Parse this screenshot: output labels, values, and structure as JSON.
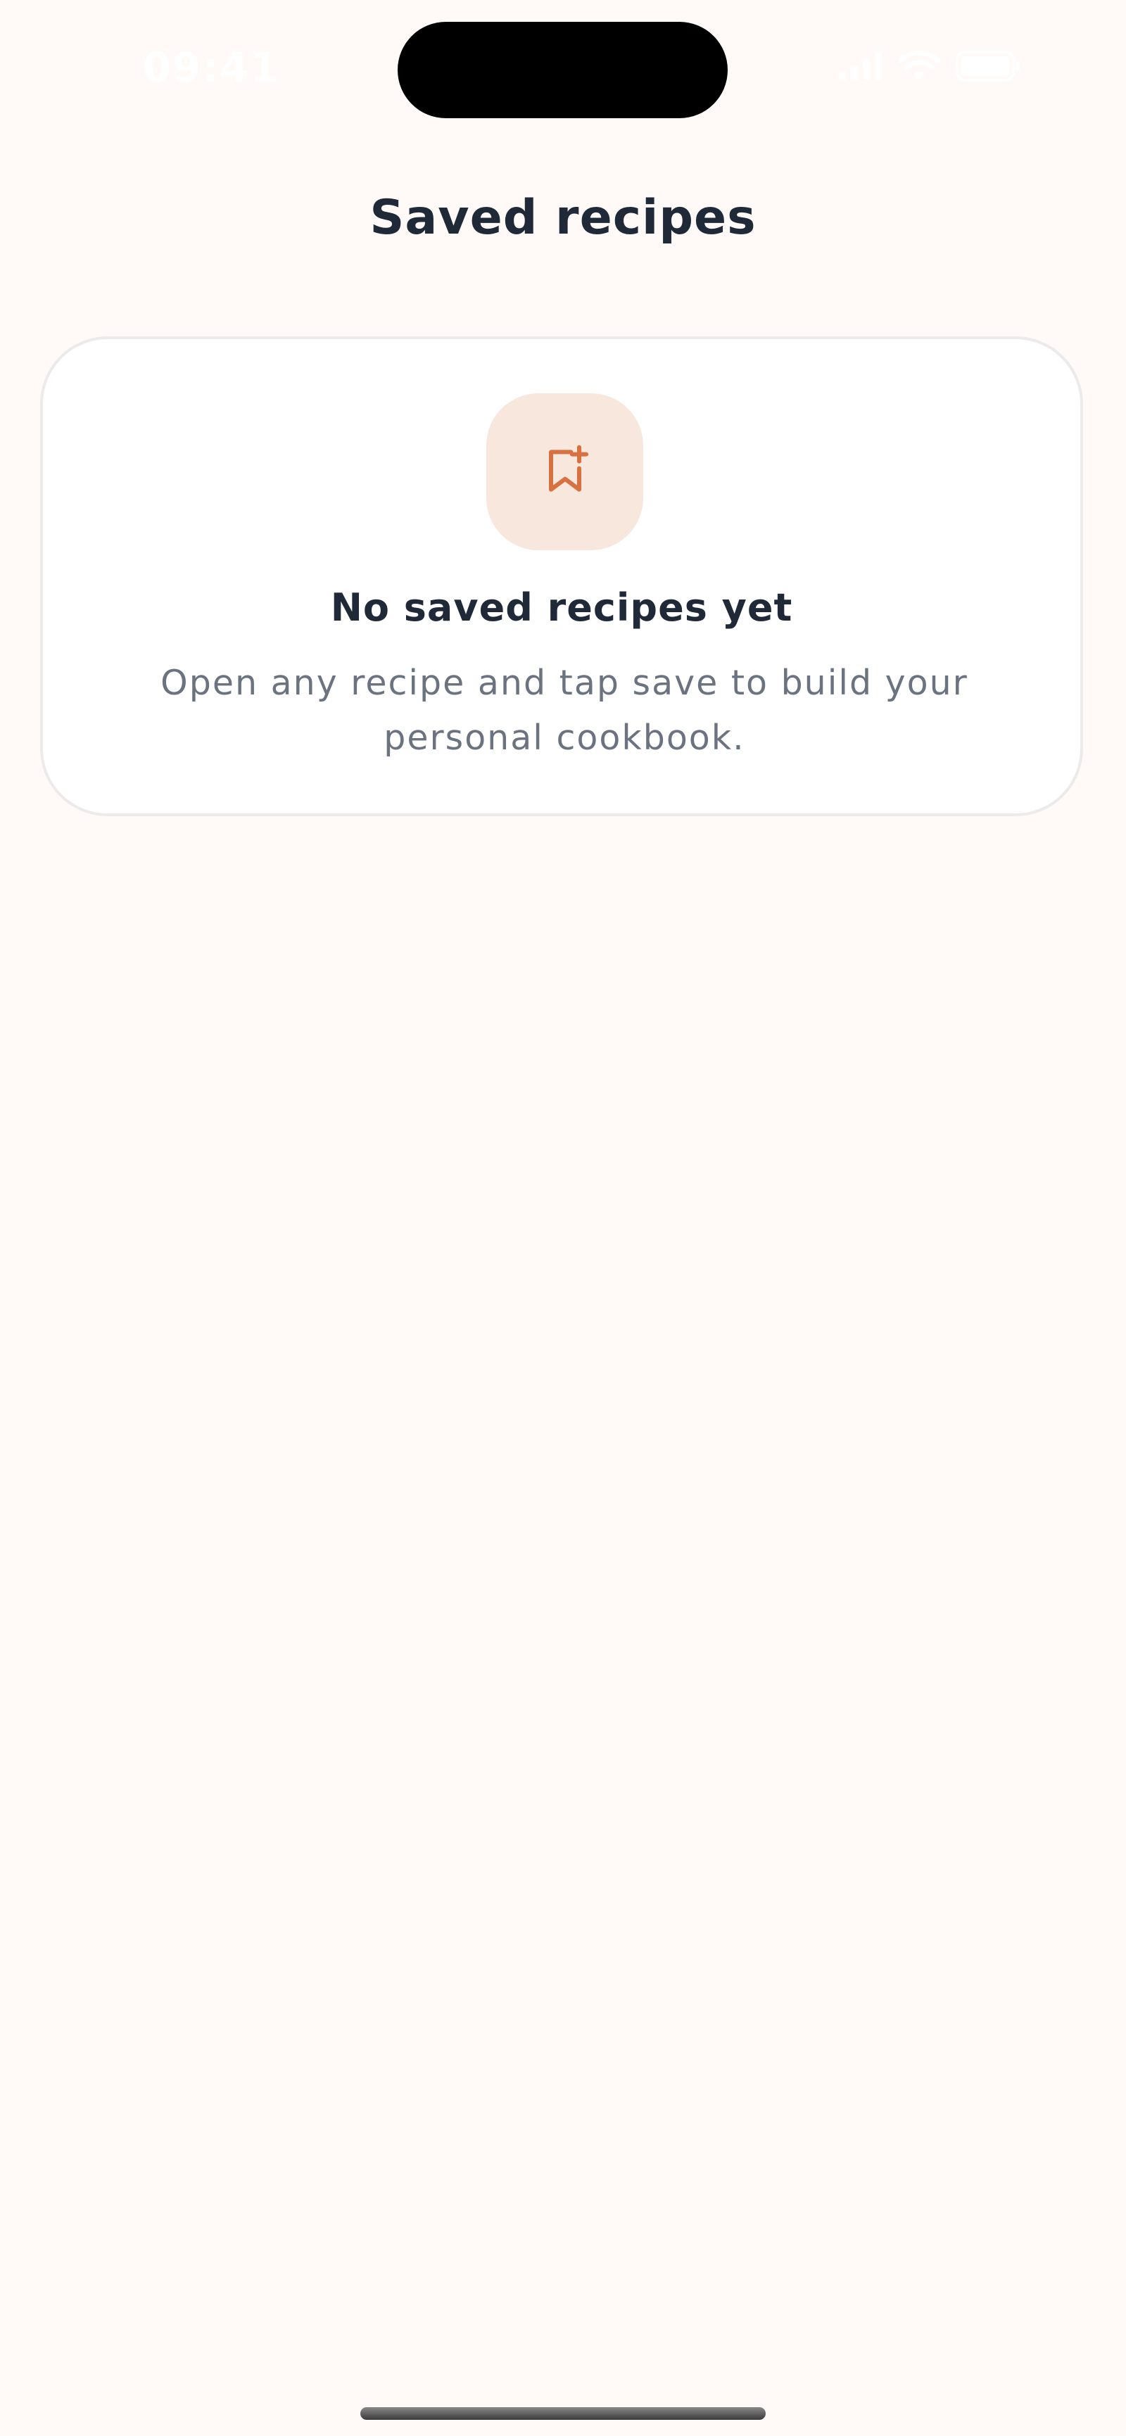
{
  "status_bar": {
    "time": "09:41"
  },
  "header": {
    "title": "Saved recipes"
  },
  "empty_state": {
    "icon": "bookmark-plus-icon",
    "title": "No saved recipes yet",
    "message": "Open any recipe and tap save to build your personal cookbook."
  },
  "colors": {
    "background": "#fffaf7",
    "accent": "#d9703f",
    "icon_tile": "#f8e7dd",
    "title_text": "#1f2937",
    "body_text": "#6b7280"
  }
}
